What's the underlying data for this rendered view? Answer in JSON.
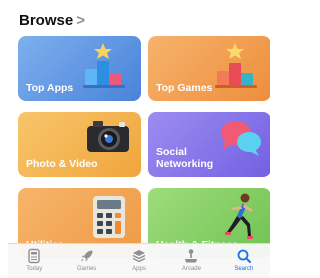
{
  "header": {
    "title": "Browse",
    "chevron": ">"
  },
  "categories": [
    {
      "label": "Top Apps"
    },
    {
      "label": "Top Games"
    },
    {
      "label": "Photo & Video"
    },
    {
      "label": "Social\nNetworking"
    },
    {
      "label": "Utilities"
    },
    {
      "label": "Health & Fitness"
    }
  ],
  "tabbar": {
    "active": "Search",
    "tabs": [
      {
        "label": "Today",
        "icon": "today-icon"
      },
      {
        "label": "Games",
        "icon": "rocket-icon"
      },
      {
        "label": "Apps",
        "icon": "layers-icon"
      },
      {
        "label": "Arcade",
        "icon": "joystick-icon"
      },
      {
        "label": "Search",
        "icon": "search-icon"
      }
    ]
  },
  "colors": {
    "accent": "#1a73e8",
    "inactive_tab": "#8e8e93"
  }
}
